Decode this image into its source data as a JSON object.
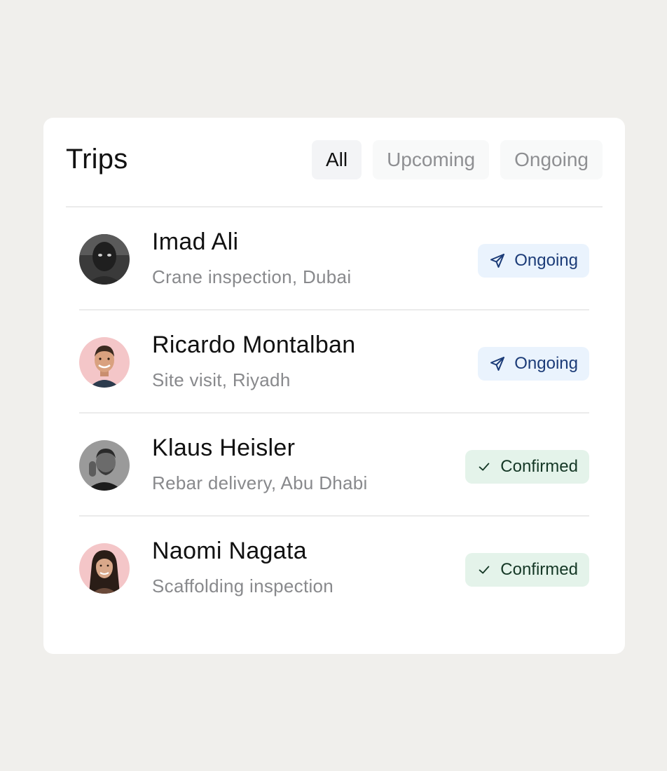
{
  "header": {
    "title": "Trips",
    "tabs": [
      {
        "label": "All",
        "active": true
      },
      {
        "label": "Upcoming",
        "active": false
      },
      {
        "label": "Ongoing",
        "active": false
      }
    ]
  },
  "trips": [
    {
      "name": "Imad Ali",
      "description": "Crane inspection, Dubai",
      "status": "Ongoing",
      "status_icon": "send-icon",
      "avatar_bg": "#3a3a3a"
    },
    {
      "name": "Ricardo Montalban",
      "description": "Site visit, Riyadh",
      "status": "Ongoing",
      "status_icon": "send-icon",
      "avatar_bg": "#f4c6c8"
    },
    {
      "name": "Klaus Heisler",
      "description": "Rebar delivery, Abu Dhabi",
      "status": "Confirmed",
      "status_icon": "check-icon",
      "avatar_bg": "#9a9a9a"
    },
    {
      "name": "Naomi Nagata",
      "description": "Scaffolding inspection",
      "status": "Confirmed",
      "status_icon": "check-icon",
      "avatar_bg": "#f4c6c8"
    }
  ],
  "colors": {
    "page_bg": "#f0efec",
    "ongoing_bg": "#eaf3fd",
    "ongoing_text": "#1c3c78",
    "confirmed_bg": "#e4f3ea",
    "confirmed_text": "#153826"
  }
}
